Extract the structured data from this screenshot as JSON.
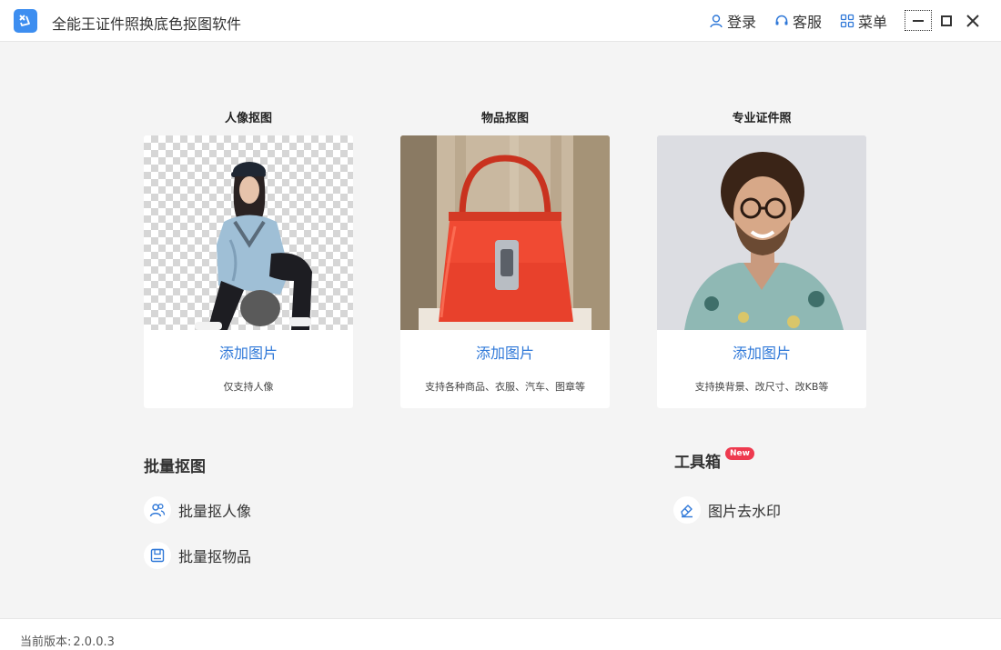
{
  "app": {
    "title": "全能王证件照换底色抠图软件",
    "icon": "app-logo-icon",
    "accent": "#3d8ef0"
  },
  "header": {
    "login": {
      "label": "登录",
      "icon": "user-icon"
    },
    "service": {
      "label": "客服",
      "icon": "headset-icon"
    },
    "menu": {
      "label": "菜单",
      "icon": "grid-icon"
    }
  },
  "cards": [
    {
      "title": "人像抠图",
      "action": "添加图片",
      "desc": "仅支持人像",
      "image": "person-cutout-photo"
    },
    {
      "title": "物品抠图",
      "action": "添加图片",
      "desc": "支持各种商品、衣服、汽车、图章等",
      "image": "red-handbag-photo"
    },
    {
      "title": "专业证件照",
      "action": "添加图片",
      "desc": "支持换背景、改尺寸、改KB等",
      "image": "man-portrait-photo"
    }
  ],
  "batch": {
    "title": "批量抠图",
    "items": [
      {
        "label": "批量抠人像",
        "icon": "people-icon"
      },
      {
        "label": "批量抠物品",
        "icon": "box-icon"
      }
    ]
  },
  "toolbox": {
    "title": "工具箱",
    "badge": "New",
    "items": [
      {
        "label": "图片去水印",
        "icon": "eraser-icon"
      }
    ]
  },
  "footer": {
    "version_label": "当前版本:",
    "version": "2.0.0.3"
  },
  "colors": {
    "link": "#2f78d8",
    "badge": "#ee3a4f",
    "background": "#f4f4f4"
  }
}
